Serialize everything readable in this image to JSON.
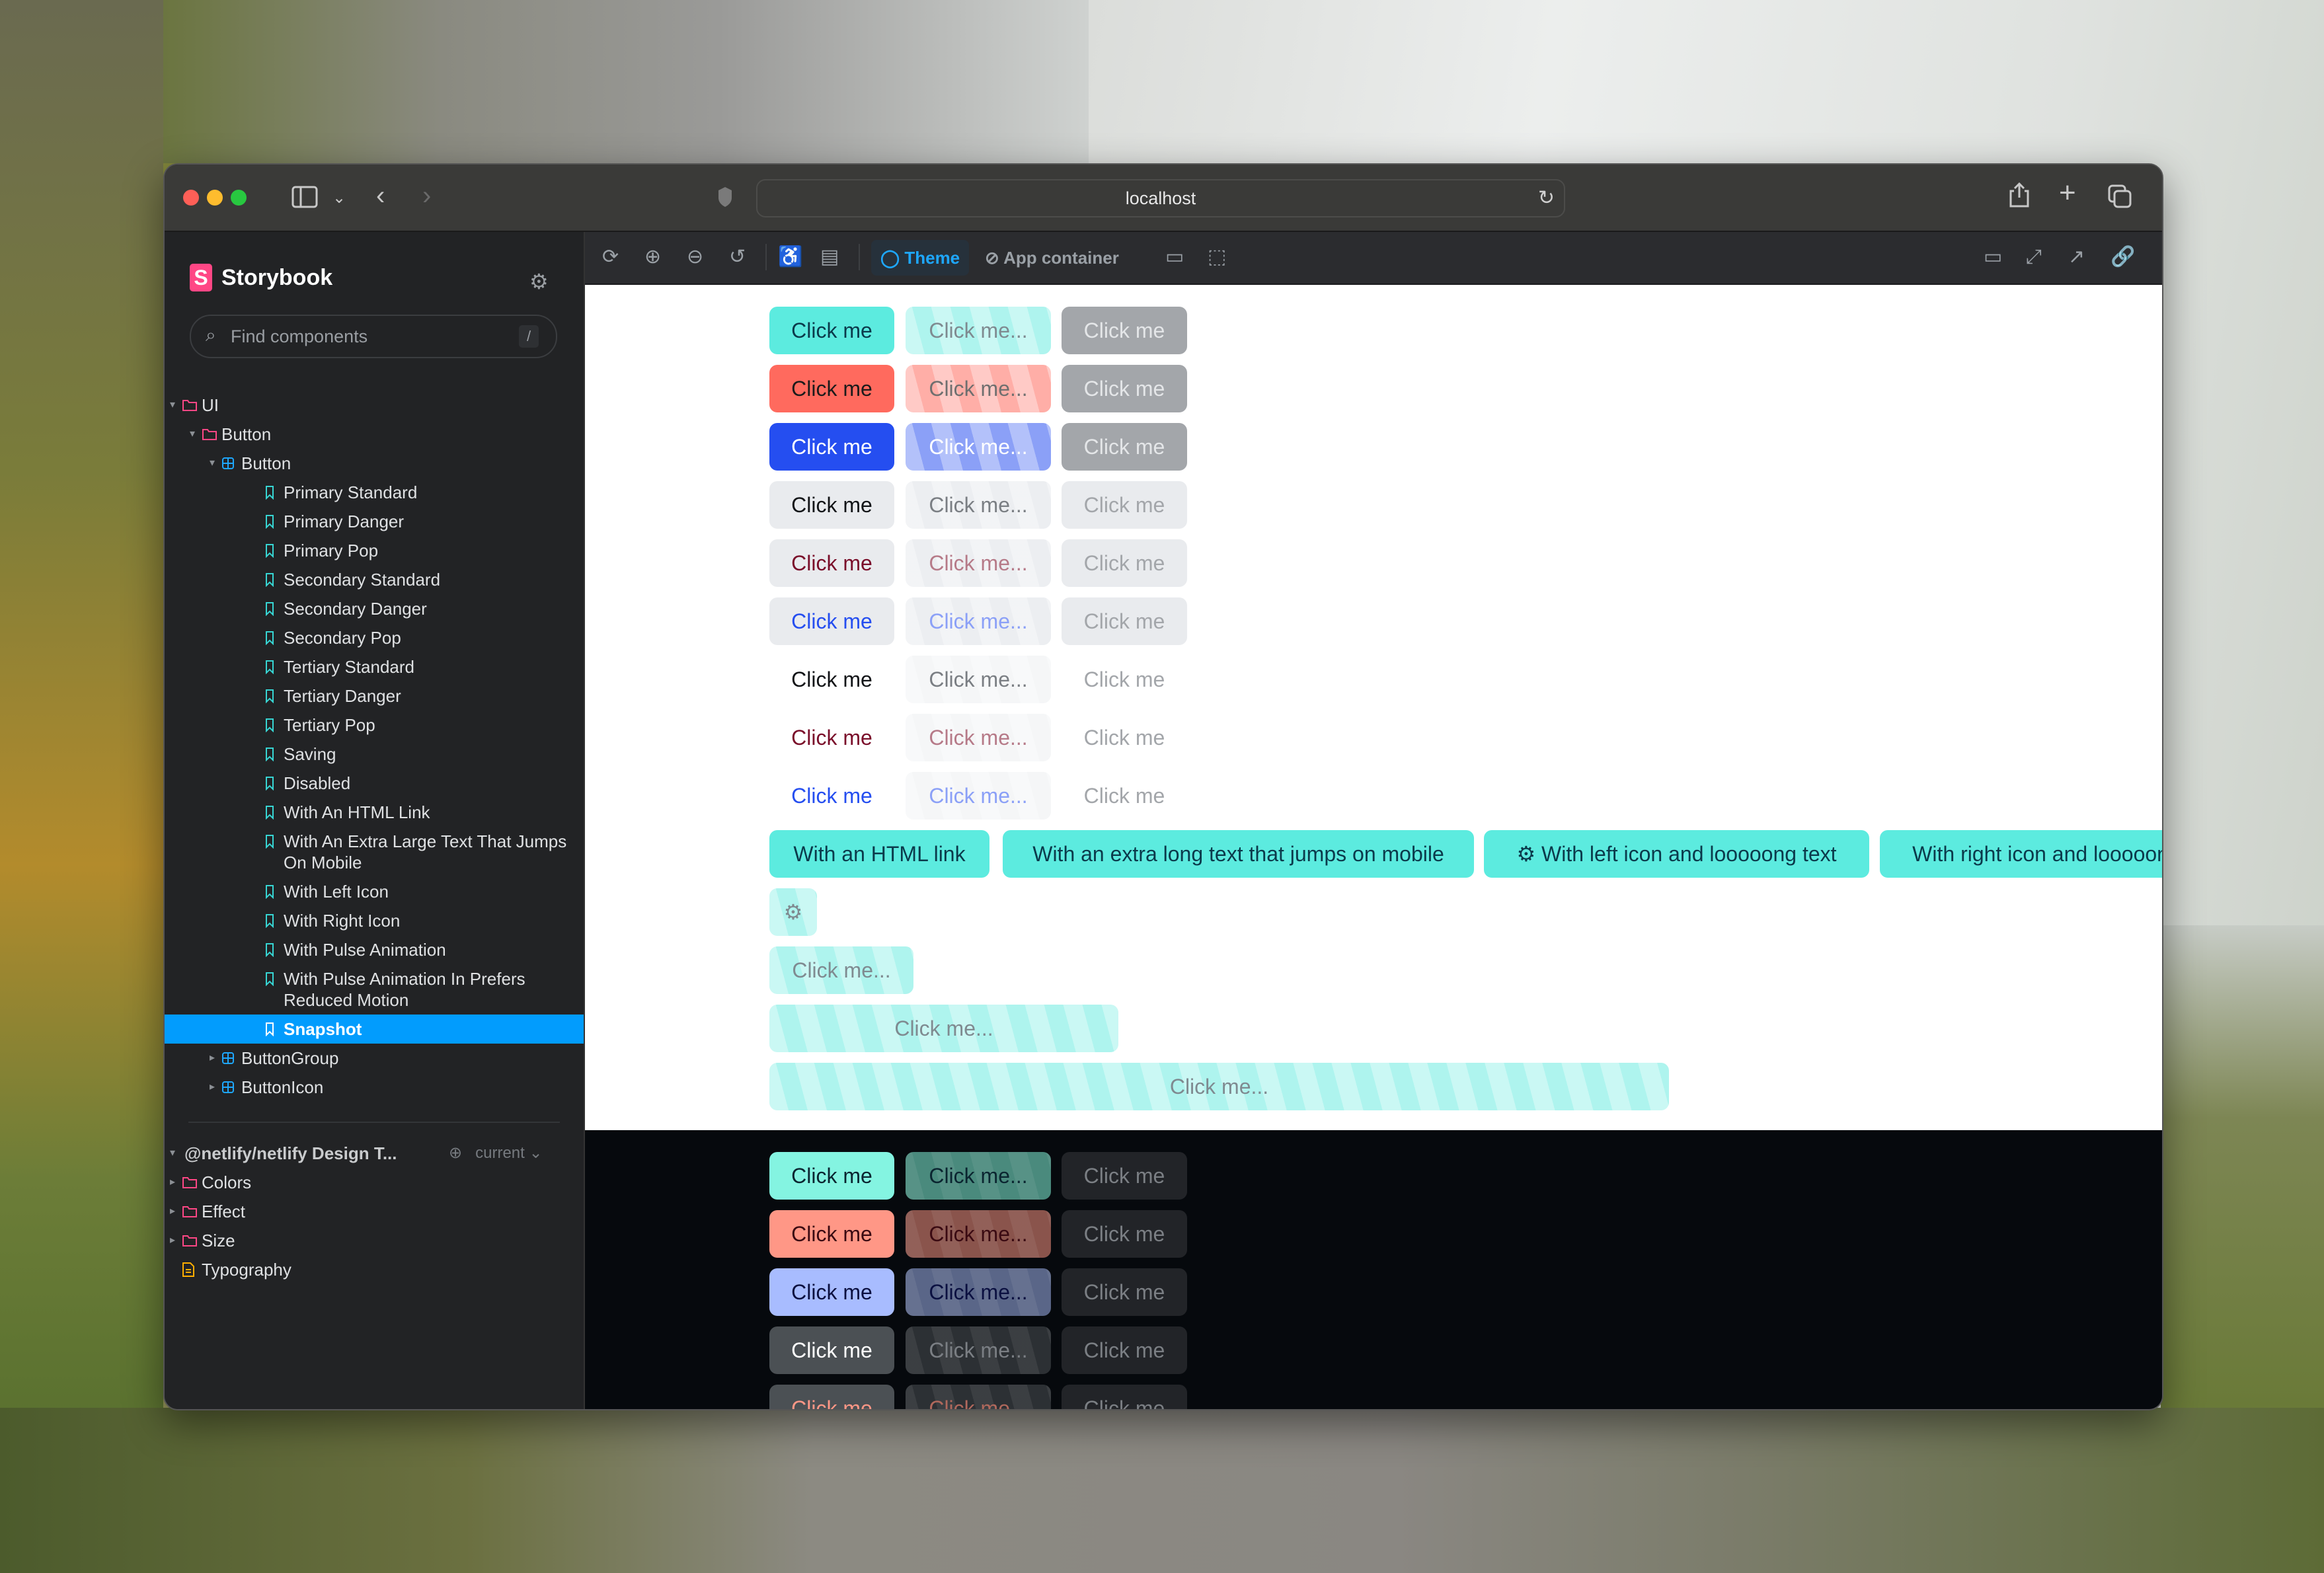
{
  "browser": {
    "url": "localhost",
    "icons": [
      "sidebar-toggle-icon",
      "chevron-down-icon",
      "back-icon",
      "forward-icon",
      "privacy-shield-icon",
      "reload-icon",
      "share-icon",
      "new-tab-icon",
      "tab-overview-icon"
    ]
  },
  "sidebar": {
    "brand": "Storybook",
    "brand_mark": "S",
    "search_placeholder": "Find components",
    "search_shortcut": "/",
    "tree": [
      {
        "label": "UI",
        "type": "folder",
        "level": 0,
        "expanded": true
      },
      {
        "label": "Button",
        "type": "folder",
        "level": 1,
        "expanded": true
      },
      {
        "label": "Button",
        "type": "component",
        "level": 2,
        "expanded": true
      },
      {
        "label": "Primary Standard",
        "type": "story",
        "level": 3
      },
      {
        "label": "Primary Danger",
        "type": "story",
        "level": 3
      },
      {
        "label": "Primary Pop",
        "type": "story",
        "level": 3
      },
      {
        "label": "Secondary Standard",
        "type": "story",
        "level": 3
      },
      {
        "label": "Secondary Danger",
        "type": "story",
        "level": 3
      },
      {
        "label": "Secondary Pop",
        "type": "story",
        "level": 3
      },
      {
        "label": "Tertiary Standard",
        "type": "story",
        "level": 3
      },
      {
        "label": "Tertiary Danger",
        "type": "story",
        "level": 3
      },
      {
        "label": "Tertiary Pop",
        "type": "story",
        "level": 3
      },
      {
        "label": "Saving",
        "type": "story",
        "level": 3
      },
      {
        "label": "Disabled",
        "type": "story",
        "level": 3
      },
      {
        "label": "With An HTML Link",
        "type": "story",
        "level": 3
      },
      {
        "label": "With An Extra Large Text That Jumps On Mobile",
        "type": "story",
        "level": 3,
        "two_line": true
      },
      {
        "label": "With Left Icon",
        "type": "story",
        "level": 3
      },
      {
        "label": "With Right Icon",
        "type": "story",
        "level": 3
      },
      {
        "label": "With Pulse Animation",
        "type": "story",
        "level": 3
      },
      {
        "label": "With Pulse Animation In Prefers Reduced Motion",
        "type": "story",
        "level": 3,
        "two_line": true
      },
      {
        "label": "Snapshot",
        "type": "story",
        "level": 3,
        "selected": true
      },
      {
        "label": "ButtonGroup",
        "type": "component",
        "level": 2,
        "expanded": false
      },
      {
        "label": "ButtonIcon",
        "type": "component",
        "level": 2,
        "expanded": false
      }
    ],
    "ref": {
      "title": "@netlify/netlify Design T...",
      "version": "current",
      "items": [
        {
          "label": "Colors",
          "type": "folder"
        },
        {
          "label": "Effect",
          "type": "folder"
        },
        {
          "label": "Size",
          "type": "folder"
        },
        {
          "label": "Typography",
          "type": "doc"
        }
      ]
    }
  },
  "toolbar": {
    "theme_label": "Theme",
    "app_container_label": "App container",
    "left_icons": [
      "remount-icon",
      "zoom-in-icon",
      "zoom-out-icon",
      "zoom-reset-icon",
      "accessibility-icon",
      "background-icon"
    ],
    "after_icons": [
      "viewport-icon",
      "outline-icon"
    ],
    "right_icons": [
      "addons-panel-icon",
      "fullscreen-icon",
      "open-new-tab-icon",
      "copy-link-icon"
    ]
  },
  "preview": {
    "light_rows": [
      {
        "variant": "primary-standard",
        "normal": "Click me",
        "saving": "Click me...",
        "disabled": "Click me",
        "colors": {
          "bg": "#5cebdf",
          "fg": "#0b3a4b",
          "saving_bg": "#aef4ee",
          "saving_fg": "#7f8a90",
          "dis_bg": "#a3a6aa",
          "dis_fg": "#e4e6e8"
        }
      },
      {
        "variant": "primary-danger",
        "normal": "Click me",
        "saving": "Click me...",
        "disabled": "Click me",
        "colors": {
          "bg": "#ff6a5e",
          "fg": "#1b1b1b",
          "saving_bg": "#ffaea7",
          "saving_fg": "#6f6f6f",
          "dis_bg": "#a3a6aa",
          "dis_fg": "#e4e6e8"
        }
      },
      {
        "variant": "primary-pop",
        "normal": "Click me",
        "saving": "Click me...",
        "disabled": "Click me",
        "colors": {
          "bg": "#254ef0",
          "fg": "#ffffff",
          "saving_bg": "#8ba0f7",
          "saving_fg": "#ffffff",
          "dis_bg": "#a3a6aa",
          "dis_fg": "#e4e6e8"
        }
      },
      {
        "variant": "secondary-standard",
        "normal": "Click me",
        "saving": "Click me...",
        "disabled": "Click me",
        "colors": {
          "bg": "#e9ebee",
          "fg": "#121417",
          "saving_bg": "#eceef1",
          "saving_fg": "#7a7e83",
          "dis_bg": "#e9ebee",
          "dis_fg": "#a3a6aa"
        }
      },
      {
        "variant": "secondary-danger",
        "normal": "Click me",
        "saving": "Click me...",
        "disabled": "Click me",
        "colors": {
          "bg": "#e9ebee",
          "fg": "#7a0e2a",
          "saving_bg": "#eceef1",
          "saving_fg": "#b67a88",
          "dis_bg": "#e9ebee",
          "dis_fg": "#a3a6aa"
        }
      },
      {
        "variant": "secondary-pop",
        "normal": "Click me",
        "saving": "Click me...",
        "disabled": "Click me",
        "colors": {
          "bg": "#e9ebee",
          "fg": "#254ef0",
          "saving_bg": "#eceef1",
          "saving_fg": "#8ba0f7",
          "dis_bg": "#e9ebee",
          "dis_fg": "#a3a6aa"
        }
      },
      {
        "variant": "tertiary-standard",
        "normal": "Click me",
        "saving": "Click me...",
        "disabled": "Click me",
        "colors": {
          "bg": "transparent",
          "fg": "#121417",
          "saving_bg": "#f5f6f7",
          "saving_fg": "#7a7e83",
          "dis_bg": "transparent",
          "dis_fg": "#a3a6aa"
        }
      },
      {
        "variant": "tertiary-danger",
        "normal": "Click me",
        "saving": "Click me...",
        "disabled": "Click me",
        "colors": {
          "bg": "transparent",
          "fg": "#7a0e2a",
          "saving_bg": "#f5f6f7",
          "saving_fg": "#b67a88",
          "dis_bg": "transparent",
          "dis_fg": "#a3a6aa"
        }
      },
      {
        "variant": "tertiary-pop",
        "normal": "Click me",
        "saving": "Click me...",
        "disabled": "Click me",
        "colors": {
          "bg": "transparent",
          "fg": "#254ef0",
          "saving_bg": "#f5f6f7",
          "saving_fg": "#8ba0f7",
          "dis_bg": "transparent",
          "dis_fg": "#a3a6aa"
        }
      }
    ],
    "wide_buttons": [
      {
        "label": "With an HTML link",
        "icon": ""
      },
      {
        "label": "With an extra long text that jumps on mobile",
        "icon": ""
      },
      {
        "label": "With left icon and looooong text",
        "icon": "left"
      },
      {
        "label": "With right icon and looooong text",
        "icon": "right"
      }
    ],
    "icon_only_button": {
      "icon": "gear-icon"
    },
    "saving_sizes": [
      {
        "label": "Click me..."
      },
      {
        "label": "Click me..."
      },
      {
        "label": "Click me..."
      }
    ],
    "dark_rows": [
      {
        "variant": "primary-standard",
        "normal": "Click me",
        "saving": "Click me...",
        "disabled": "Click me",
        "colors": {
          "bg": "#84f4e1",
          "fg": "#0b2530",
          "saving_bg": "#4a8a7d",
          "saving_fg": "#0b2530",
          "dis_bg": "#222428",
          "dis_fg": "#7b7f84"
        }
      },
      {
        "variant": "primary-danger",
        "normal": "Click me",
        "saving": "Click me...",
        "disabled": "Click me",
        "colors": {
          "bg": "#ff9786",
          "fg": "#3a0a12",
          "saving_bg": "#8a544c",
          "saving_fg": "#3a0a12",
          "dis_bg": "#222428",
          "dis_fg": "#7b7f84"
        }
      },
      {
        "variant": "primary-pop",
        "normal": "Click me",
        "saving": "Click me...",
        "disabled": "Click me",
        "colors": {
          "bg": "#a8bcff",
          "fg": "#0b1040",
          "saving_bg": "#5a6688",
          "saving_fg": "#0b1040",
          "dis_bg": "#222428",
          "dis_fg": "#7b7f84"
        }
      },
      {
        "variant": "secondary-standard",
        "normal": "Click me",
        "saving": "Click me...",
        "disabled": "Click me",
        "colors": {
          "bg": "#4b5054",
          "fg": "#ffffff",
          "saving_bg": "#2c3034",
          "saving_fg": "#7b7f84",
          "dis_bg": "#222428",
          "dis_fg": "#7b7f84"
        }
      },
      {
        "variant": "secondary-danger",
        "normal": "Click me",
        "saving": "Click me...",
        "disabled": "Click me",
        "colors": {
          "bg": "#4b5054",
          "fg": "#ff9786",
          "saving_bg": "#2c3034",
          "saving_fg": "#b0685c",
          "dis_bg": "#222428",
          "dis_fg": "#7b7f84"
        }
      }
    ]
  }
}
